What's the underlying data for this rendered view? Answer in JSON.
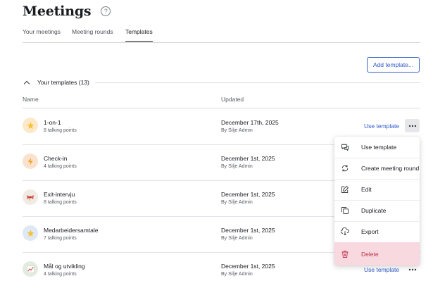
{
  "page": {
    "title": "Meetings"
  },
  "tabs": [
    {
      "label": "Your meetings",
      "active": false
    },
    {
      "label": "Meeting rounds",
      "active": false
    },
    {
      "label": "Templates",
      "active": true
    }
  ],
  "toolbar": {
    "add_label": "Add template..."
  },
  "section": {
    "title": "Your templates (13)"
  },
  "table": {
    "columns": [
      "Name",
      "Updated"
    ],
    "rows": [
      {
        "name": "1-on-1",
        "points": "8 talking points",
        "date": "December 17th, 2025",
        "by": "By Silje Admin",
        "action": "Use template",
        "icon": "star-icon",
        "icon_bg": "#fbe9c9"
      },
      {
        "name": "Check-in",
        "points": "4 talking points",
        "date": "December 1st, 2025",
        "by": "By Silje Admin",
        "action": "Use template",
        "icon": "lightning-icon",
        "icon_bg": "#fbe2cf"
      },
      {
        "name": "Exit-intervju",
        "points": "8 talking points",
        "date": "December 1st, 2025",
        "by": "By Silje Admin",
        "action": "Use template",
        "icon": "bow-icon",
        "icon_bg": "#f1ebe6"
      },
      {
        "name": "Medarbeidersamtale",
        "points": "7 talking points",
        "date": "December 1st, 2025",
        "by": "By Silje Admin",
        "action": "Use template",
        "icon": "star-icon",
        "icon_bg": "#dfe8f5"
      },
      {
        "name": "Mål og utvikling",
        "points": "4 talking points",
        "date": "December 1st, 2025",
        "by": "By Silje Admin",
        "action": "Use template",
        "icon": "chart-icon",
        "icon_bg": "#e3ecdf"
      }
    ]
  },
  "menu": {
    "items": [
      {
        "label": "Use template",
        "icon": "chat-icon"
      },
      {
        "label": "Create meeting round",
        "icon": "repeat-chat-icon"
      },
      {
        "label": "Edit",
        "icon": "edit-icon"
      },
      {
        "label": "Duplicate",
        "icon": "copy-icon"
      },
      {
        "label": "Export",
        "icon": "cloud-download-icon"
      },
      {
        "label": "Delete",
        "icon": "trash-icon"
      }
    ]
  },
  "colors": {
    "accent": "#2f59c5",
    "danger": "#c1324f",
    "danger_bg": "#f7d9df"
  }
}
